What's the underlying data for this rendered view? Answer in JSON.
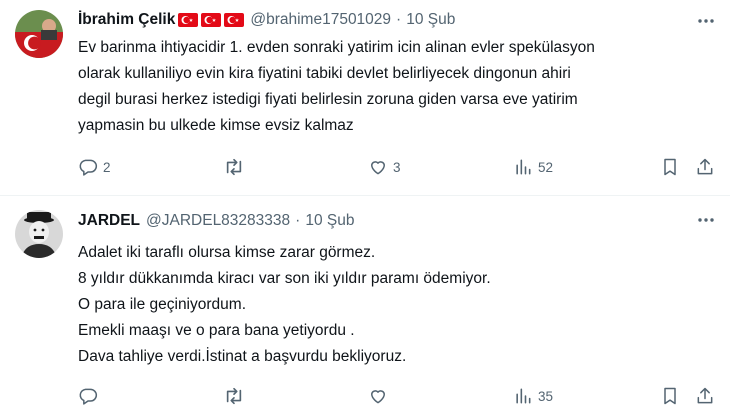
{
  "tweets": [
    {
      "name": "İbrahim Çelik",
      "handle": "@brahime17501029",
      "separator": "·",
      "date": "10 Şub",
      "flag_color": "#e30a17",
      "avatar_color": "#c81b20",
      "lines": [
        "Ev barinma ihtiyacidir 1. evden sonraki yatirim icin alinan evler spekülasyon",
        "olarak kullaniliyo evin kira fiyatini tabiki devlet belirliyecek dingonun ahiri",
        "degil burasi herkez istedigi fiyati belirlesin zoruna giden varsa eve yatirim",
        "yapmasin bu ulkede kimse evsiz kalmaz"
      ],
      "replies": "2",
      "retweets": "",
      "likes": "3",
      "views": "52"
    },
    {
      "name": "JARDEL",
      "handle": "@JARDEL83283338",
      "separator": "·",
      "date": "10 Şub",
      "avatar_color": "#2a2a2a",
      "lines": [
        "Adalet iki taraflı olursa kimse zarar görmez.",
        "8 yıldır dükkanımda kiracı var son iki yıldır paramı ödemiyor.",
        "O para ile geçiniyordum.",
        "Emekli maaşı ve o para bana yetiyordu .",
        "Dava tahliye verdi.İstinat a başvurdu bekliyoruz."
      ],
      "replies": "",
      "retweets": "",
      "likes": "",
      "views": "35"
    }
  ],
  "icons": {
    "reply": "reply-icon",
    "retweet": "retweet-icon",
    "like": "heart-icon",
    "views": "views-icon",
    "bookmark": "bookmark-icon",
    "share": "share-icon",
    "more": "more-icon"
  },
  "colors": {
    "text": "#0f1419",
    "muted": "#536471",
    "divider": "#eff3f4"
  }
}
